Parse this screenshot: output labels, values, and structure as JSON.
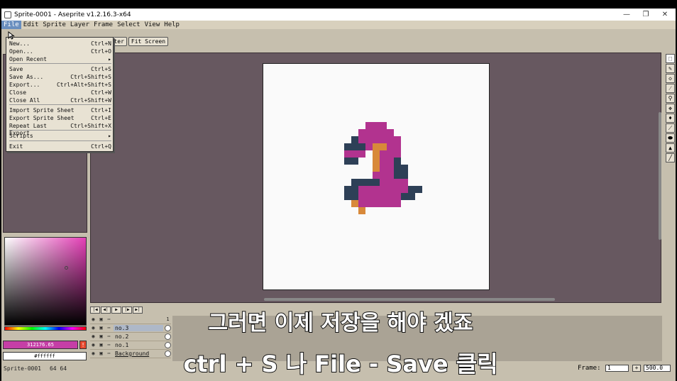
{
  "window": {
    "title": "Sprite-0001 - Aseprite v1.2.16.3-x64",
    "controls": {
      "minimize": "—",
      "maximize": "❐",
      "close": "✕"
    }
  },
  "menubar": {
    "items": [
      {
        "label": "File",
        "active": true
      },
      {
        "label": "Edit"
      },
      {
        "label": "Sprite"
      },
      {
        "label": "Layer"
      },
      {
        "label": "Frame"
      },
      {
        "label": "Select"
      },
      {
        "label": "View"
      },
      {
        "label": "Help"
      }
    ]
  },
  "toolbar": {
    "center_label": "Center",
    "fit_label": "Fit Screen"
  },
  "file_menu": {
    "items": [
      {
        "label": "New...",
        "shortcut": "Ctrl+N"
      },
      {
        "label": "Open...",
        "shortcut": "Ctrl+O"
      },
      {
        "label": "Open Recent",
        "shortcut": "▸"
      },
      {
        "label": "Save",
        "shortcut": "Ctrl+S"
      },
      {
        "label": "Save As...",
        "shortcut": "Ctrl+Shift+S"
      },
      {
        "label": "Export...",
        "shortcut": "Ctrl+Alt+Shift+S"
      },
      {
        "label": "Close",
        "shortcut": "Ctrl+W"
      },
      {
        "label": "Close All",
        "shortcut": "Ctrl+Shift+W"
      },
      {
        "label": "Import Sprite Sheet",
        "shortcut": "Ctrl+I"
      },
      {
        "label": "Export Sprite Sheet",
        "shortcut": "Ctrl+E"
      },
      {
        "label": "Repeat Last Export",
        "shortcut": "Ctrl+Shift+X"
      },
      {
        "label": "Scripts",
        "shortcut": "▸"
      },
      {
        "label": "Exit",
        "shortcut": "Ctrl+Q"
      }
    ]
  },
  "colors": {
    "foreground_hex": "312176.65",
    "background_hex": "#ffffff",
    "foreground": "#c53ea6",
    "canvas_bg": "#675860",
    "sprite_magenta": "#b2338f",
    "sprite_navy": "#2e4057",
    "sprite_orange": "#d8893a"
  },
  "layers": [
    {
      "name": "no.3",
      "selected": true
    },
    {
      "name": "no.2"
    },
    {
      "name": "no.1"
    },
    {
      "name": "Background"
    }
  ],
  "timeline": {
    "frame_number": "1"
  },
  "status": {
    "sprite_name": "Sprite-0001",
    "sprite_size": "64 64",
    "frame_label": "Frame:",
    "frame_value": "1",
    "zoom_value": "500.0"
  },
  "subtitles": {
    "line1": "그러면 이제 저장을 해야 겠죠",
    "line2": "ctrl + S 나 File - Save 클릭"
  }
}
